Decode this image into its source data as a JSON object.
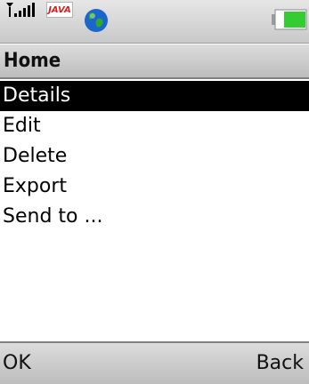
{
  "status_bar": {
    "signal_icon": "signal-strength-icon",
    "java_badge": "JAVA",
    "globe_icon": "globe-icon",
    "battery_icon": "battery-icon",
    "colors": {
      "battery_fill": "#33cc33",
      "globe_blue": "#1a66cc",
      "globe_green": "#2fa82f"
    }
  },
  "title_bar": {
    "title": "Home"
  },
  "menu": {
    "items": [
      {
        "label": "Details",
        "selected": true
      },
      {
        "label": "Edit",
        "selected": false
      },
      {
        "label": "Delete",
        "selected": false
      },
      {
        "label": "Export",
        "selected": false
      },
      {
        "label": "Send to ...",
        "selected": false
      }
    ]
  },
  "softkeys": {
    "left_label": "OK",
    "right_label": "Back"
  }
}
